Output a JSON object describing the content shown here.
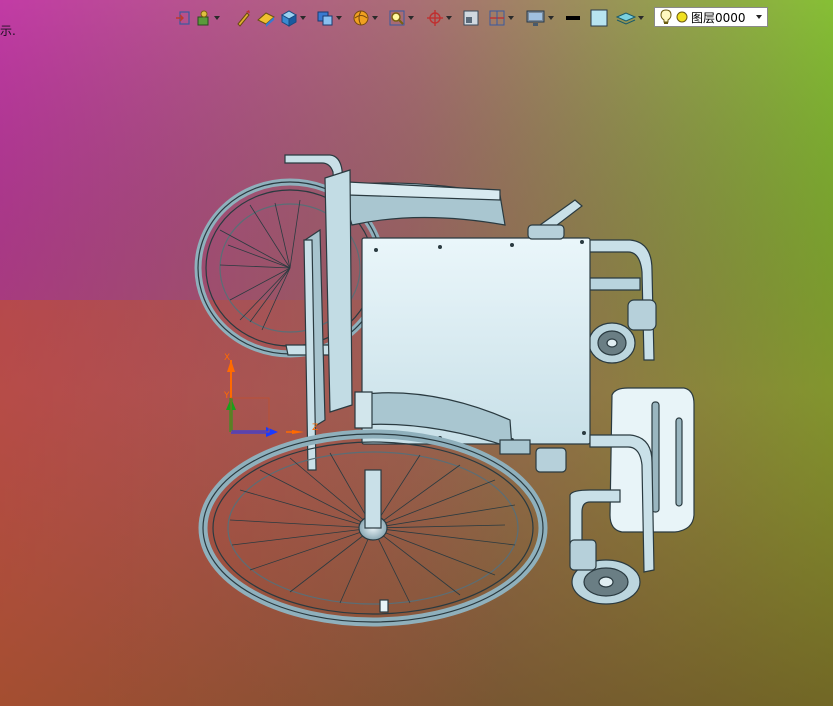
{
  "viewport": {
    "hint_text": "示.",
    "background": {
      "top_left": "#c03aa8",
      "top_right": "#86c035",
      "bottom_left": "#bf5a28",
      "bottom_right": "#6a5a2a"
    },
    "model": {
      "name": "wheelchair",
      "color": "#b8d4de",
      "edge_color": "#2a3a40"
    },
    "triad": {
      "x_label": "X",
      "y_label": "Y",
      "z_label": "Z",
      "x_color": "#ff6a00",
      "y_color": "#1aa01a",
      "z_color": "#1a3aff"
    }
  },
  "toolbar": {
    "icons": [
      "exit-sketch-icon",
      "layer-manager-icon",
      "sketch-pen-icon",
      "erase-icon",
      "solid-box-icon",
      "view-orient-icon",
      "shaded-sphere-icon",
      "zoom-icon",
      "origin-icon",
      "frame-icon",
      "section-icon",
      "display-icon",
      "line-color-icon",
      "fill-color-icon",
      "layers-stack-icon"
    ],
    "layer_selector": {
      "value": "图层0000"
    }
  }
}
